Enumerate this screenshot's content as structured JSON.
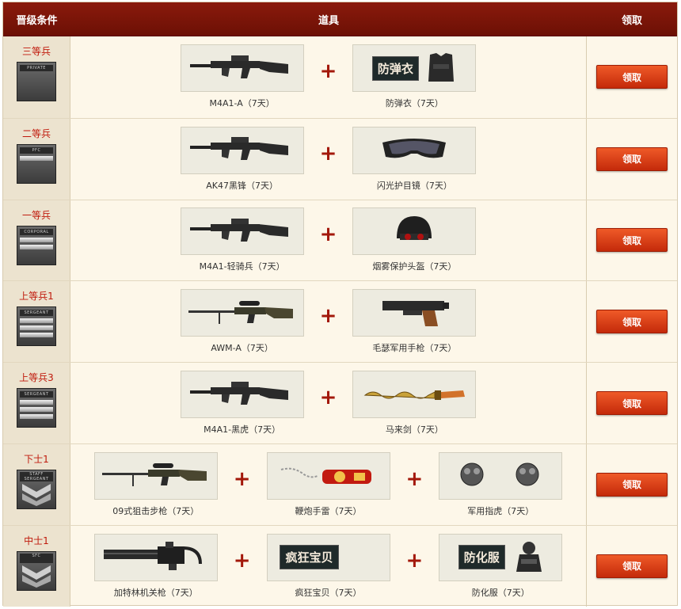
{
  "header": {
    "rank_col": "晋级条件",
    "items_col": "道具",
    "claim_col": "领取"
  },
  "rows": [
    {
      "rank": "三等兵",
      "insignia": "PRIVATE",
      "claim": "领取",
      "items": [
        {
          "label": "M4A1-A（7天）",
          "icon": "rifle-icon"
        },
        {
          "label": "防弹衣（7天）",
          "icon": "vest-icon",
          "badge": "防弹衣"
        }
      ]
    },
    {
      "rank": "二等兵",
      "insignia": "PFC",
      "claim": "领取",
      "items": [
        {
          "label": "AK47黑锋（7天）",
          "icon": "rifle-icon"
        },
        {
          "label": "闪光护目镜（7天）",
          "icon": "goggles-icon"
        }
      ]
    },
    {
      "rank": "一等兵",
      "insignia": "CORPORAL",
      "claim": "领取",
      "items": [
        {
          "label": "M4A1-轻骑兵（7天）",
          "icon": "rifle-icon"
        },
        {
          "label": "烟雾保护头盔（7天）",
          "icon": "helmet-icon"
        }
      ]
    },
    {
      "rank": "上等兵1",
      "insignia": "SERGEANT",
      "claim": "领取",
      "items": [
        {
          "label": "AWM-A（7天）",
          "icon": "sniper-icon"
        },
        {
          "label": "毛瑟军用手枪（7天）",
          "icon": "pistol-icon"
        }
      ]
    },
    {
      "rank": "上等兵3",
      "insignia": "SERGEANT",
      "claim": "领取",
      "items": [
        {
          "label": "M4A1-黑虎（7天）",
          "icon": "rifle-icon"
        },
        {
          "label": "马来剑（7天）",
          "icon": "kris-sword-icon"
        }
      ]
    },
    {
      "rank": "下士1",
      "insignia": "STAFF SERGEANT",
      "claim": "领取",
      "items": [
        {
          "label": "09式狙击步枪（7天）",
          "icon": "sniper-icon"
        },
        {
          "label": "鞭炮手雷（7天）",
          "icon": "firecracker-icon"
        },
        {
          "label": "军用指虎（7天）",
          "icon": "knuckles-icon"
        }
      ]
    },
    {
      "rank": "中士1",
      "insignia": "SFC",
      "claim": "领取",
      "items": [
        {
          "label": "加特林机关枪（7天）",
          "icon": "minigun-icon"
        },
        {
          "label": "疯狂宝贝（7天）",
          "icon": "character-icon",
          "badge": "疯狂宝贝"
        },
        {
          "label": "防化服（7天）",
          "icon": "hazmat-suit-icon",
          "badge": "防化服"
        }
      ]
    }
  ]
}
